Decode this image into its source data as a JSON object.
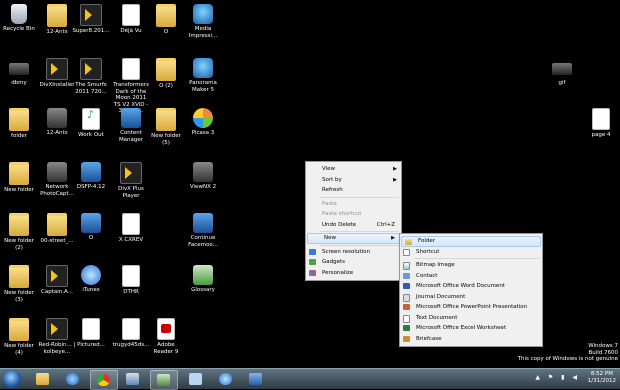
{
  "desktop_icons": [
    {
      "label": "Recycle Bin",
      "icon": "recycle-bin-icon"
    },
    {
      "label": "12-Ants",
      "icon": "folder-icon"
    },
    {
      "label": "Super8.201...",
      "icon": "divx-icon"
    },
    {
      "label": "Déjà Vu",
      "icon": "document-icon"
    },
    {
      "label": "O",
      "icon": "folder-icon"
    },
    {
      "label": "Media Impressi...",
      "icon": "media-icon"
    },
    {
      "label": "dbmy",
      "icon": "camera-icon"
    },
    {
      "label": "DivXInstaller",
      "icon": "divx-icon"
    },
    {
      "label": "The Smurfs 2011 720...",
      "icon": "divx-icon"
    },
    {
      "label": "Transformers Dark of the Moon 2011 TS V2 XViD - 3Lt4RB...",
      "icon": "document-icon"
    },
    {
      "label": "O (2)",
      "icon": "folder-icon"
    },
    {
      "label": "Panorama Maker 5",
      "icon": "media-icon"
    },
    {
      "label": "gif",
      "icon": "camera-icon"
    },
    {
      "label": "folder",
      "icon": "folder-icon"
    },
    {
      "label": "12-Ants",
      "icon": "gray-icon"
    },
    {
      "label": "Work Out",
      "icon": "music-icon"
    },
    {
      "label": "Content Manager",
      "icon": "blue-icon"
    },
    {
      "label": "New folder (5)",
      "icon": "folder-icon"
    },
    {
      "label": "Picasa 3",
      "icon": "picasa-icon"
    },
    {
      "label": "page 4",
      "icon": "document-icon"
    },
    {
      "label": "New folder",
      "icon": "folder-icon"
    },
    {
      "label": "Network PhotoCapt...",
      "icon": "gray-icon"
    },
    {
      "label": "DSFP-4.12",
      "icon": "blue-icon"
    },
    {
      "label": "DivX Plus Player",
      "icon": "divx-icon"
    },
    {
      "label": "ViewNX 2",
      "icon": "gray-icon"
    },
    {
      "label": "New folder (2)",
      "icon": "folder-icon"
    },
    {
      "label": "00-street_...",
      "icon": "folder-icon"
    },
    {
      "label": "O",
      "icon": "blue-icon"
    },
    {
      "label": "X CXREV",
      "icon": "document-icon"
    },
    {
      "label": "Continue Facemoo...",
      "icon": "blue-icon"
    },
    {
      "label": "New folder (3)",
      "icon": "folder-icon"
    },
    {
      "label": "Captain.A...",
      "icon": "divx-icon"
    },
    {
      "label": "iTunes",
      "icon": "itunes-icon"
    },
    {
      "label": "DTHR",
      "icon": "document-icon"
    },
    {
      "label": "Glossary",
      "icon": "green-icon"
    },
    {
      "label": "New folder (4)",
      "icon": "folder-icon"
    },
    {
      "label": "Red-Robin... | kolbeye...",
      "icon": "divx-icon"
    },
    {
      "label": "Pictured...",
      "icon": "document-icon"
    },
    {
      "label": "trugyd45ds...",
      "icon": "document-icon"
    },
    {
      "label": "Adobe Reader 9",
      "icon": "pdf-icon"
    }
  ],
  "context_menu": {
    "items": [
      {
        "label": "View",
        "submenu": true
      },
      {
        "label": "Sort by",
        "submenu": true
      },
      {
        "label": "Refresh"
      },
      {
        "label": "Paste",
        "disabled": true
      },
      {
        "label": "Paste shortcut",
        "disabled": true
      },
      {
        "label": "Undo Delete",
        "shortcut": "Ctrl+Z"
      },
      {
        "label": "New",
        "submenu": true,
        "highlighted": true
      },
      {
        "label": "Screen resolution",
        "icon": "screen-resolution-icon"
      },
      {
        "label": "Gadgets",
        "icon": "gadgets-icon"
      },
      {
        "label": "Personalize",
        "icon": "personalize-icon"
      }
    ]
  },
  "new_submenu": {
    "items": [
      {
        "label": "Folder",
        "icon": "folder-icon",
        "highlighted": true
      },
      {
        "label": "Shortcut",
        "icon": "shortcut-icon"
      },
      {
        "label": "Bitmap Image",
        "icon": "bitmap-icon"
      },
      {
        "label": "Contact",
        "icon": "contact-icon"
      },
      {
        "label": "Microsoft Office Word Document",
        "icon": "word-icon"
      },
      {
        "label": "Journal Document",
        "icon": "journal-icon"
      },
      {
        "label": "Microsoft Office PowerPoint Presentation",
        "icon": "powerpoint-icon"
      },
      {
        "label": "Text Document",
        "icon": "text-icon"
      },
      {
        "label": "Microsoft Office Excel Worksheet",
        "icon": "excel-icon"
      },
      {
        "label": "Briefcase",
        "icon": "briefcase-icon"
      }
    ]
  },
  "watermark": {
    "line1": "Windows 7",
    "line2": "Build 7600",
    "line3": "This copy of Windows is not genuine"
  },
  "taskbar": {
    "time": "8:52 PM",
    "date": "1/31/2012"
  }
}
